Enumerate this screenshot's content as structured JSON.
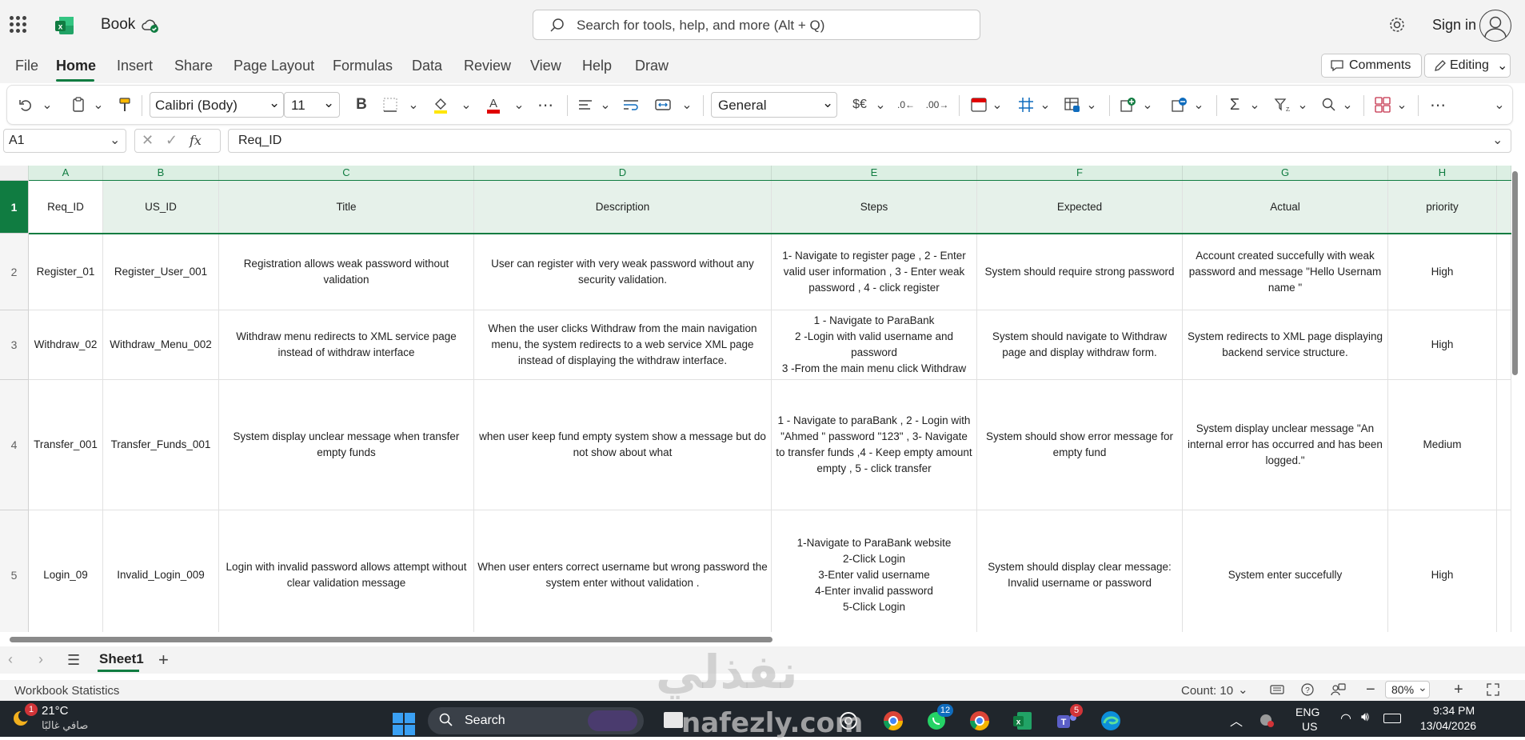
{
  "titlebar": {
    "app_title": "Book",
    "search_placeholder": "Search for tools, help, and more (Alt + Q)",
    "signin_label": "Sign in"
  },
  "menu": {
    "items": [
      "File",
      "Home",
      "Insert",
      "Share",
      "Page Layout",
      "Formulas",
      "Data",
      "Review",
      "View",
      "Help",
      "Draw"
    ],
    "comments_label": "Comments",
    "editing_label": "Editing"
  },
  "ribbon": {
    "font_name": "Calibri (Body)",
    "font_size": "11",
    "number_format": "General",
    "bold_label": "B"
  },
  "formula_bar": {
    "name_box": "A1",
    "formula": "Req_ID",
    "fx_label": "fx"
  },
  "columns": [
    "A",
    "B",
    "C",
    "D",
    "E",
    "F",
    "G",
    "H"
  ],
  "rows": [
    {
      "num": "1",
      "cells": [
        "Req_ID",
        "US_ID",
        "Title",
        "Description",
        "Steps",
        "Expected",
        "Actual",
        "priority"
      ]
    },
    {
      "num": "2",
      "cells": [
        "Register_01",
        "Register_User_001",
        "Registration allows weak password without validation",
        "User can register with very weak password without any security validation.",
        "1- Navigate to register page , 2 - Enter valid user information , 3 - Enter weak password , 4 - click register",
        "System should require strong password",
        "Account created succefully with weak password and message \"Hello Usernam name \"",
        "High"
      ]
    },
    {
      "num": "3",
      "cells": [
        "Withdraw_02",
        "Withdraw_Menu_002",
        "Withdraw menu redirects to XML service page instead of withdraw interface",
        "When the user clicks Withdraw from the main navigation menu, the system redirects to a web service XML page instead of displaying the withdraw interface.",
        "1 - Navigate to ParaBank\n2 -Login with valid username and password\n3 -From the main menu click Withdraw",
        "System should navigate to Withdraw page and display withdraw form.",
        "System redirects to XML page displaying backend service structure.",
        "High"
      ]
    },
    {
      "num": "4",
      "cells": [
        "Transfer_001",
        "Transfer_Funds_001",
        "System display unclear message when transfer empty funds",
        "when user keep fund empty system show a message but do not show about  what",
        "1 - Navigate to paraBank , 2 - Login with \"Ahmed \" password \"123\" , 3- Navigate to transfer funds ,4 - Keep empty amount empty , 5 - click transfer",
        "System should show error message for empty fund",
        "System display unclear message  \"An internal error has occurred and has been logged.\"",
        "Medium"
      ]
    },
    {
      "num": "5",
      "cells": [
        "Login_09",
        "Invalid_Login_009",
        "Login with invalid password allows attempt without clear validation message",
        "When user enters correct username but wrong password the system enter without validation .",
        "1-Navigate to ParaBank website\n2-Click Login\n3-Enter valid username\n4-Enter invalid password\n5-Click Login",
        "System should display clear message:\nInvalid username or password",
        "System enter succefully",
        "High"
      ]
    }
  ],
  "sheets": {
    "active": "Sheet1"
  },
  "status": {
    "left": "Workbook Statistics",
    "count": "Count: 10",
    "zoom": "80%"
  },
  "taskbar": {
    "weather_temp": "21°C",
    "weather_desc": "صافي غالبًا",
    "search_label": "Search",
    "lang_top": "ENG",
    "lang_bottom": "US",
    "time": "9:34 PM",
    "date": "13/04/2026",
    "badge_weather": "1",
    "badge_whatsapp": "12",
    "badge_teams": "5"
  },
  "watermark": {
    "arabic": "نفذلي",
    "latin": "nafezly.com"
  },
  "colors": {
    "excel_green": "#107c41",
    "header_fill": "#e6f1ea"
  }
}
